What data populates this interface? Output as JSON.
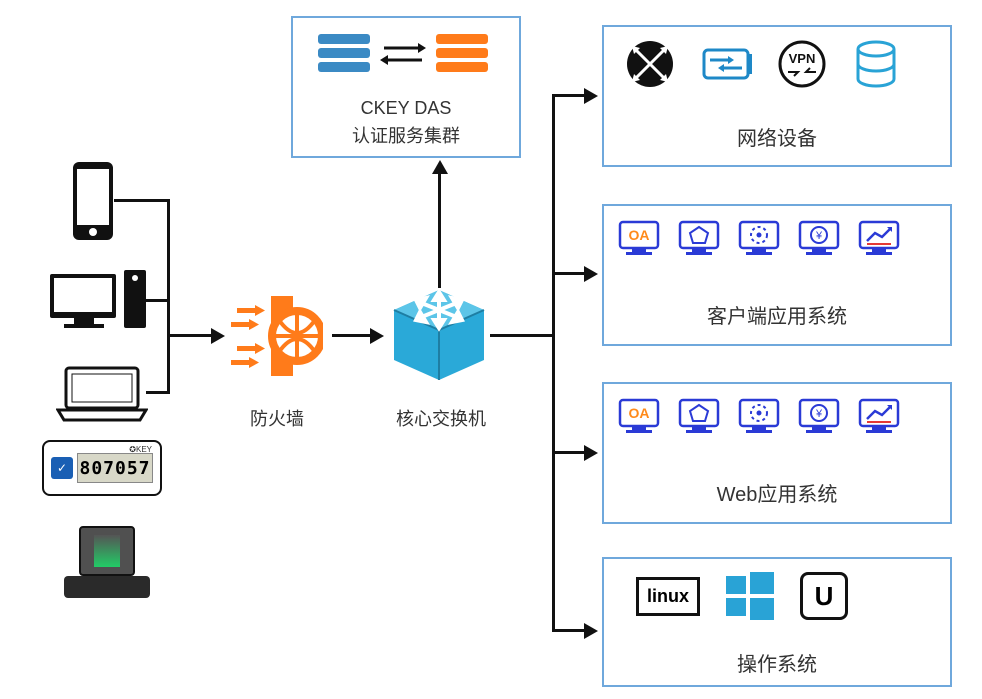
{
  "cluster": {
    "line1": "CKEY DAS",
    "line2": "认证服务集群"
  },
  "firewall_label": "防火墙",
  "switch_label": "核心交换机",
  "boxes": {
    "net": "网络设备",
    "client": "客户端应用系统",
    "web": "Web应用系统",
    "os": "操作系统"
  },
  "token_code": "807057",
  "app_oa": "OA",
  "os_linux": "linux",
  "os_u": "U"
}
